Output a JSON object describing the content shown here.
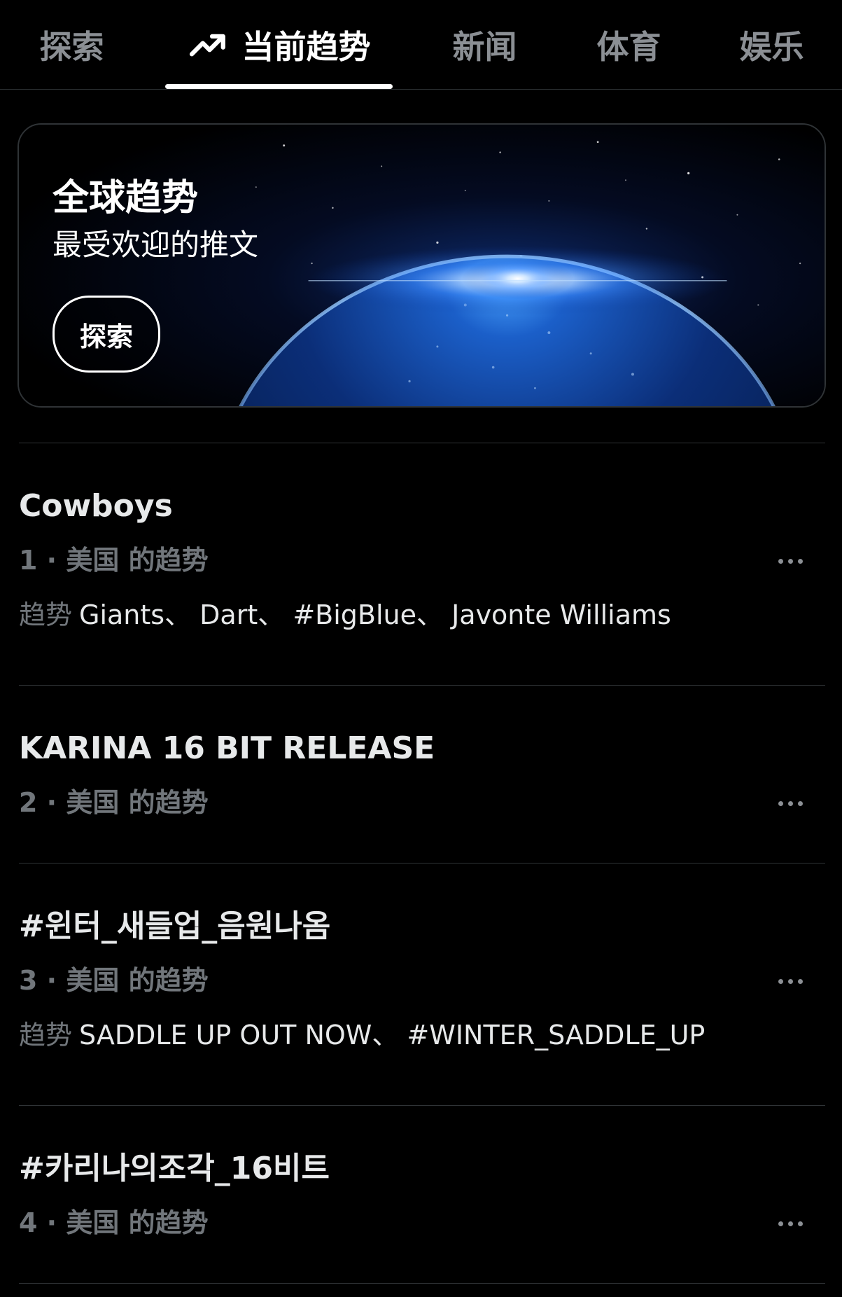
{
  "tabs": [
    {
      "label": "探索",
      "active": false
    },
    {
      "label": "当前趋势",
      "active": true,
      "icon": "trending-icon"
    },
    {
      "label": "新闻",
      "active": false
    },
    {
      "label": "体育",
      "active": false
    },
    {
      "label": "娱乐",
      "active": false
    }
  ],
  "hero": {
    "title": "全球趋势",
    "subtitle": "最受欢迎的推文",
    "button_label": "探索",
    "image": "earth-horizon-sunrise"
  },
  "trends": [
    {
      "title": "Cowboys",
      "meta": "1 · 美国 的趋势",
      "related_label": "趋势",
      "related": "Giants、 Dart、 #BigBlue、 Javonte Williams"
    },
    {
      "title": "KARINA 16 BIT RELEASE",
      "meta": "2 · 美国 的趋势"
    },
    {
      "title": "#윈터_새들업_음원나옴",
      "meta": "3 · 美国 的趋势",
      "related_label": "趋势",
      "related": "SADDLE UP OUT NOW、 #WINTER_SADDLE_UP"
    },
    {
      "title": "#카리나의조각_16비트",
      "meta": "4 · 美国 的趋势"
    }
  ],
  "colors": {
    "background": "#000000",
    "primary_text": "#e7e9ea",
    "secondary_text": "#71767b",
    "divider": "#2f3336"
  }
}
